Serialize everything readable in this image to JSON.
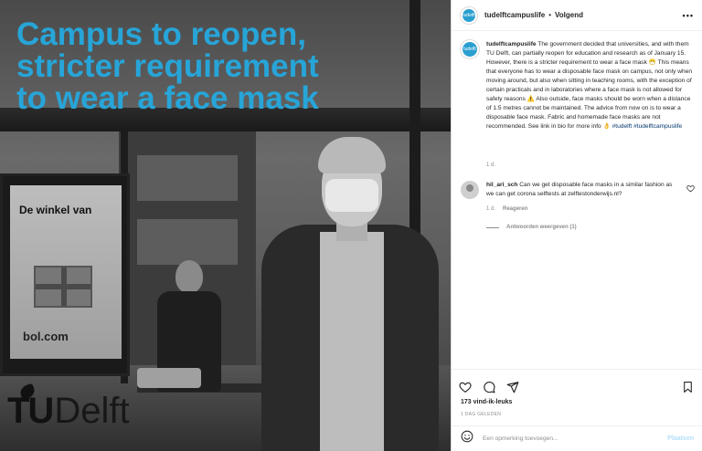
{
  "image": {
    "headline": [
      "Campus to reopen,",
      "stricter requirement",
      "to wear a face mask"
    ],
    "ad_title": "De winkel van",
    "ad_brand": "bol.com",
    "logo_tu": "TU",
    "logo_delft": "Delft",
    "headline_color": "#27a5d8"
  },
  "post": {
    "username": "tudelftcampuslife",
    "avatar_text": "tudelft",
    "separator": "•",
    "follow_label": "Volgend",
    "more_icon": "more-horizontal-icon",
    "caption_user": "tudelftcampuslife",
    "caption_text": "The government decided that universities, and with them TU Delft, can partially reopen for education and research as of January 15. However, there is a stricter requirement to wear a face mask 😷 This means that everyone has to wear a disposable face mask on campus, not only when moving around, but also when sitting in teaching rooms, with the exception of certain practicals and in laboratories where a face mask is not allowed for safety reasons ⚠️ Also outside, face masks should be worn when a distance of 1.5 metres cannot be maintained. The advice from now on is to wear a disposable face mask. Fabric and homemade face masks are not recommended. See link in bio for more info 👌",
    "caption_tags": "#tudelft #tudelftcampuslife",
    "caption_time": "1 d.",
    "comment": {
      "user": "hil_ari_sch",
      "text": "Can we get disposable face masks in a similar fashion as we can get corona selftests at zelftestonderwijs.nl?",
      "time": "1 d.",
      "reply_label": "Reageren",
      "view_replies": "Antwoorden weergeven (1)"
    },
    "likes": "173 vind-ik-leuks",
    "ago": "1 DAG GELEDEN",
    "comment_placeholder": "Een opmerking toevoegen...",
    "post_button": "Plaatsen"
  }
}
